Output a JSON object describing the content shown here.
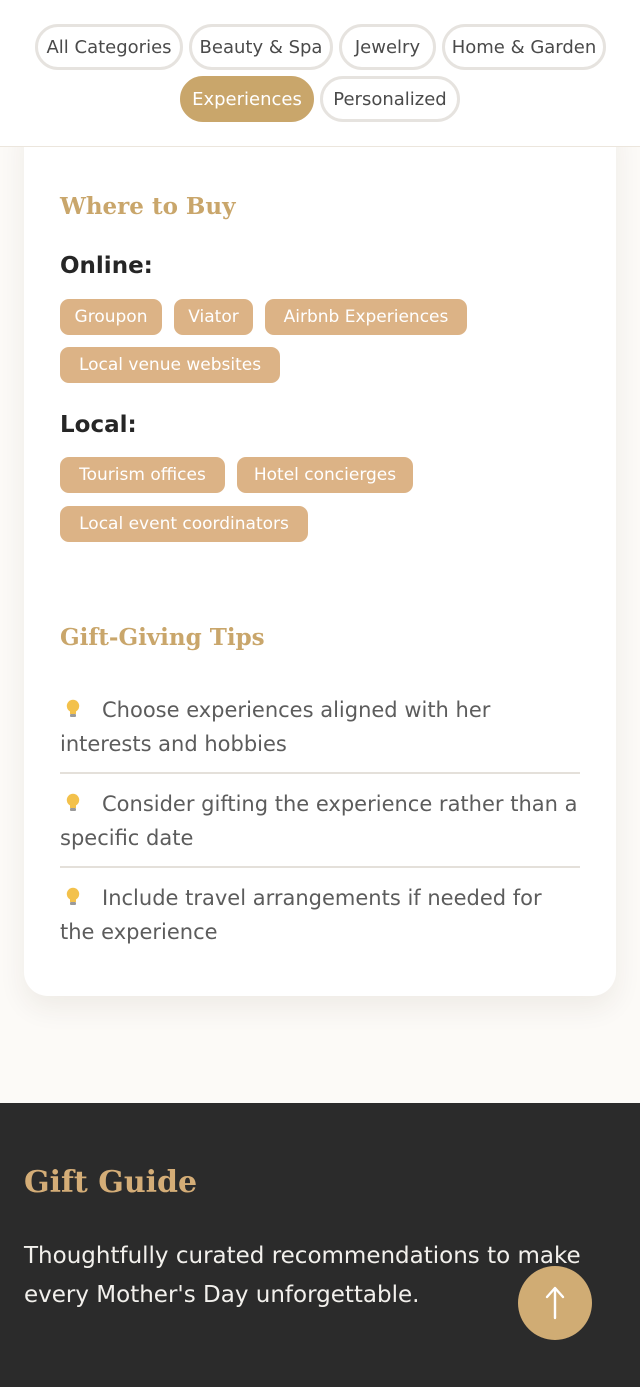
{
  "categories": [
    {
      "label": "All Categories",
      "active": false
    },
    {
      "label": "Beauty & Spa",
      "active": false
    },
    {
      "label": "Jewelry",
      "active": false
    },
    {
      "label": "Home & Garden",
      "active": false
    },
    {
      "label": "Experiences",
      "active": true
    },
    {
      "label": "Personalized",
      "active": false
    }
  ],
  "where_to_buy": {
    "title": "Where to Buy",
    "online_label": "Online:",
    "online_tags": [
      "Groupon",
      "Viator",
      "Airbnb Experiences",
      "Local venue websites"
    ],
    "local_label": "Local:",
    "local_tags": [
      "Tourism offices",
      "Hotel concierges",
      "Local event coordinators"
    ]
  },
  "tips": {
    "title": "Gift-Giving Tips",
    "icon": "lightbulb-icon",
    "items": [
      "Choose experiences aligned with her interests and hobbies",
      "Consider gifting the experience rather than a specific date",
      "Include travel arrangements if needed for the experience"
    ]
  },
  "footer": {
    "title": "Gift Guide",
    "text": "Thoughtfully curated recommendations to make every Mother's Day unforgettable."
  },
  "back_to_top": {
    "icon": "arrow-up-icon",
    "glyph": "↑"
  },
  "colors": {
    "accent": "#c9a66b",
    "tag": "#dcb386",
    "footer_bg": "#2b2b2b"
  }
}
